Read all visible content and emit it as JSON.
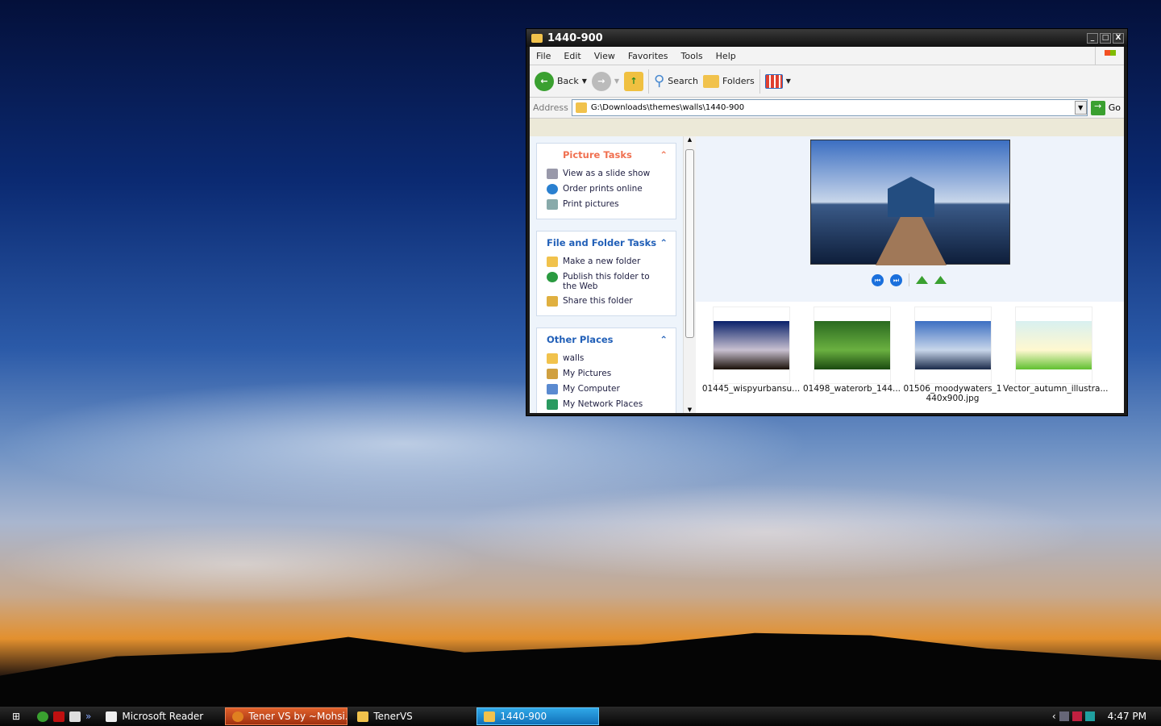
{
  "window": {
    "title": "1440-900",
    "controls": [
      "_",
      "□",
      "X"
    ]
  },
  "menu": [
    "File",
    "Edit",
    "View",
    "Favorites",
    "Tools",
    "Help"
  ],
  "toolbar": {
    "back": "Back",
    "search": "Search",
    "folders": "Folders"
  },
  "address": {
    "label": "Address",
    "value": "G:\\Downloads\\themes\\walls\\1440-900",
    "go": "Go"
  },
  "panels": [
    {
      "title": "Picture Tasks",
      "items": [
        "View as a slide show",
        "Order prints online",
        "Print pictures"
      ]
    },
    {
      "title": "File and Folder Tasks",
      "items": [
        "Make a new folder",
        "Publish this folder to the Web",
        "Share this folder"
      ]
    },
    {
      "title": "Other Places",
      "items": [
        "walls",
        "My Pictures",
        "My Computer",
        "My Network Places"
      ]
    }
  ],
  "files": [
    {
      "name": "01445_wispyurbansu...",
      "colors": [
        "#08206a",
        "#c8c0d0",
        "#1a1008"
      ]
    },
    {
      "name": "01498_waterorb_144...",
      "colors": [
        "#2a6a20",
        "#6ab040",
        "#1a4a10"
      ]
    },
    {
      "name": "01506_moodywaters_1440x900.jpg",
      "colors": [
        "#3c6fc2",
        "#c8d6ea",
        "#1a2a4a"
      ]
    },
    {
      "name": "Vector_autumn_illustra...",
      "colors": [
        "#d8f0f0",
        "#fff8d0",
        "#60c030"
      ]
    }
  ],
  "taskbar": {
    "quicklaunch": "»",
    "tasks": [
      "Microsoft Reader",
      "Tener VS by ~Mohsi...",
      "TenerVS",
      "1440-900"
    ],
    "clock": "4:47 PM"
  }
}
